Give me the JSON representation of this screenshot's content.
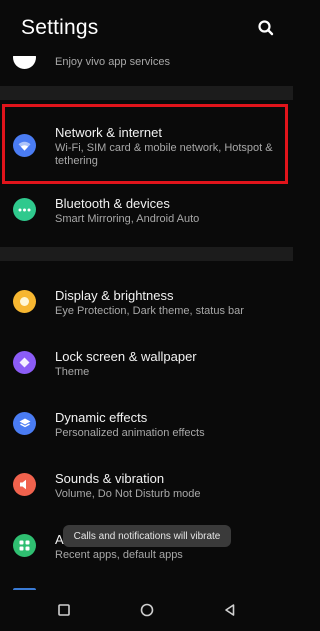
{
  "header": {
    "title": "Settings",
    "search_icon": "search-icon"
  },
  "items": [
    {
      "title": "",
      "subtitle": "Enjoy vivo app services",
      "icon": "account-icon",
      "color": "#ffffff"
    },
    {
      "title": "Network & internet",
      "subtitle": "Wi-Fi, SIM card & mobile network, Hotspot & tethering",
      "icon": "wifi-icon",
      "color": "#4a7cf3"
    },
    {
      "title": "Bluetooth & devices",
      "subtitle": "Smart Mirroring, Android Auto",
      "icon": "bluetooth-icon",
      "color": "#2fc98d"
    },
    {
      "title": "Display & brightness",
      "subtitle": "Eye Protection, Dark theme, status bar",
      "icon": "sun-icon",
      "color": "#f7b731"
    },
    {
      "title": "Lock screen & wallpaper",
      "subtitle": "Theme",
      "icon": "palette-icon",
      "color": "#8b5cf6"
    },
    {
      "title": "Dynamic effects",
      "subtitle": "Personalized animation effects",
      "icon": "layers-icon",
      "color": "#4a7cf3"
    },
    {
      "title": "Sounds & vibration",
      "subtitle": "Volume, Do Not Disturb mode",
      "icon": "speaker-icon",
      "color": "#f0624d"
    },
    {
      "title": "A",
      "subtitle": "Recent apps, default apps",
      "icon": "apps-grid-icon",
      "color": "#2fbf71"
    }
  ],
  "toast": {
    "text": "Calls and notifications will vibrate"
  },
  "navbar": {
    "recents": "square-icon",
    "home": "circle-icon",
    "back": "triangle-back-icon"
  }
}
